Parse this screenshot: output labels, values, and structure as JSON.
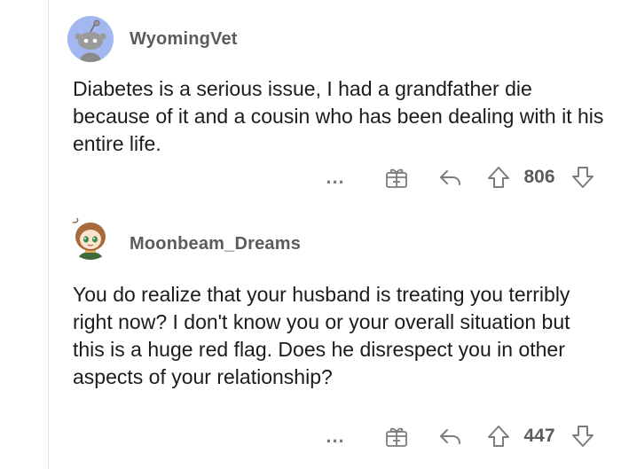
{
  "comments": [
    {
      "username": "WyomingVet",
      "avatar_icon": "snoo-default-avatar-icon",
      "avatar_bg": "#a3b7f0",
      "body": "Diabetes is a serious issue, I had a grandfather die because of it and a cousin who has been dealing with it his entire life.",
      "more_label": "...",
      "score": "806"
    },
    {
      "username": "Moonbeam_Dreams",
      "avatar_icon": "anime-girl-avatar-icon",
      "body": "You do realize that your husband is treating you terribly right now? I don't know you or your overall situation but this is a huge red flag. Does he disrespect you in other aspects of your relationship?",
      "more_label": "...",
      "score": "447"
    }
  ],
  "icons": {
    "more": "more-options-icon",
    "award": "gift-award-icon",
    "reply": "reply-arrow-icon",
    "upvote": "upvote-arrow-icon",
    "downvote": "downvote-arrow-icon"
  },
  "colors": {
    "text": "#1c1c1c",
    "meta": "#5c5c5c",
    "icon": "#7c7c7c",
    "thread_line": "#e5e5e5"
  }
}
